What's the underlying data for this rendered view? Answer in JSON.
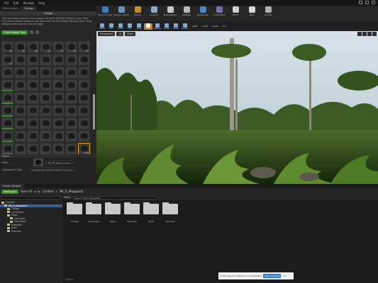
{
  "menubar": {
    "items": [
      "File",
      "Edit",
      "Window",
      "Help"
    ]
  },
  "left_panel": {
    "tabs": [
      "Place Actors",
      "Foliage"
    ],
    "header": "Foliage",
    "help_text": "Click and drag directly in the viewport to paint selected foliage in your level. Ctrl-click to select foliage in your level and use the foliage instance tools. Drag foliage assets into this area to begin.",
    "add_foliage_label": "+ Add Foliage Type",
    "grid_numbers": [
      "26",
      "32",
      "26",
      "22",
      "14",
      "15",
      "20",
      "16",
      "",
      "",
      "",
      "",
      "",
      "",
      "",
      "",
      "",
      "",
      "",
      "",
      "",
      "",
      "",
      "",
      "",
      "",
      "",
      "",
      "",
      "",
      "",
      "",
      "",
      "",
      "",
      "",
      "",
      "",
      "",
      "",
      "",
      "",
      "",
      "",
      "",
      "",
      "",
      "",
      "",
      "",
      "",
      "",
      "",
      "",
      "",
      "",
      "",
      "",
      "",
      "",
      "",
      "",
      "",
      "",
      "",
      "",
      "",
      "",
      "",
      "",
      "",
      ""
    ],
    "selected_tile_number": "1234"
  },
  "details": {
    "header": "Details",
    "rows": [
      {
        "label": "Mesh",
        "value": "SM_FB_Sparse_Grass"
      },
      {
        "label": "Component Class",
        "value": "FoliageInstancedStaticMeshComponent"
      }
    ]
  },
  "toolbar": {
    "buttons": [
      "Save Current",
      "Source Control",
      "Modes",
      "Content",
      "Marketplace",
      "Settings",
      "Blueprints",
      "Cinematics",
      "Build",
      "Play",
      "Launch"
    ],
    "colors": [
      "#3b7cc4",
      "#6a8fb8",
      "#c98a2e",
      "#8fa9c8",
      "#c7c7c7",
      "#b8b8b8",
      "#4a84c9",
      "#7a6ca8",
      "#cfcfcf",
      "#d8d8d8",
      "#b0b0b0"
    ]
  },
  "modes_toolbar": {
    "tools": [
      "Select",
      "All",
      "Invalid",
      "Fill",
      "Lasso",
      "Paint",
      "Reapply",
      "Single",
      "Erase",
      "Remove"
    ],
    "active_index": 5,
    "values": [
      "4096",
      "1.000",
      "0.000",
      "1.0"
    ]
  },
  "viewport": {
    "perspective_label": "Perspective",
    "lit_label": "Lit",
    "show_label": "Show"
  },
  "content_browser": {
    "tab_label": "Content Browser",
    "add_new_label": "Add/Import",
    "save_all_label": "Save All",
    "breadcrumb": [
      "Content",
      "PN_FI_Megapack"
    ],
    "search_placeholder": "Search PN_FI_Megapack",
    "filters_label": "Filters",
    "tree": [
      {
        "label": "Content",
        "indent": 0
      },
      {
        "label": "PN_FI_Megapack",
        "indent": 1,
        "selected": true
      },
      {
        "label": "Foliage",
        "indent": 2
      },
      {
        "label": "Landscape",
        "indent": 2
      },
      {
        "label": "Maps",
        "indent": 2
      },
      {
        "label": "Controller",
        "indent": 3
      },
      {
        "label": "Post_Maps",
        "indent": 3
      },
      {
        "label": "Materials",
        "indent": 2
      },
      {
        "label": "Mesh",
        "indent": 2
      },
      {
        "label": "Textures",
        "indent": 2
      }
    ],
    "folders": [
      "Foliage",
      "Landscape",
      "Maps",
      "Materials",
      "Mesh",
      "Textures"
    ],
    "item_count": "6 items"
  },
  "toast": {
    "message": "Unreal Engine is Starting Live Compilation",
    "button_label": "Stop Compiling",
    "link_label": "Hide"
  }
}
